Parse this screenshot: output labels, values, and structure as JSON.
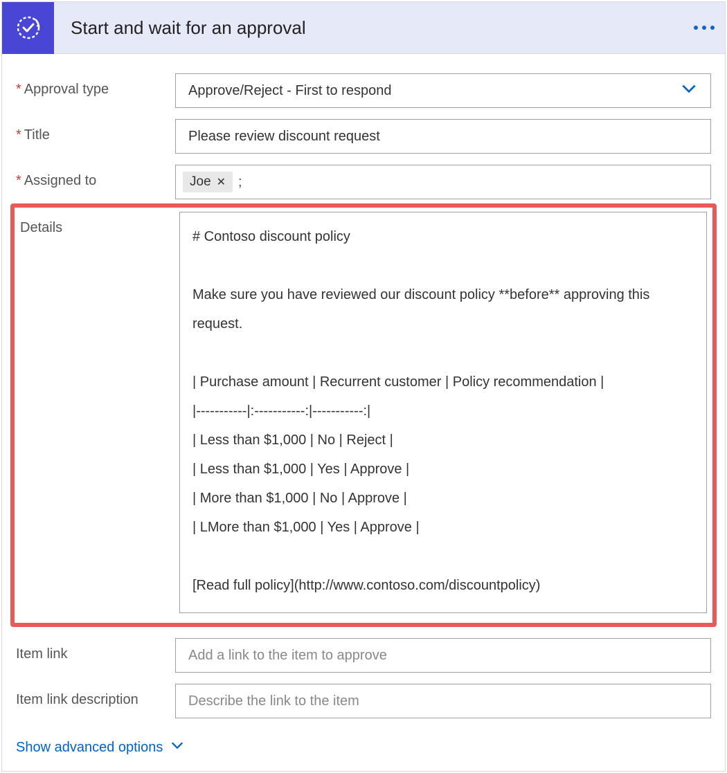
{
  "header": {
    "title": "Start and wait for an approval",
    "icon": "approval-check-icon"
  },
  "fields": {
    "approval_type": {
      "label": "Approval type",
      "value": "Approve/Reject - First to respond",
      "required": true
    },
    "title": {
      "label": "Title",
      "value": "Please review discount request",
      "required": true
    },
    "assigned_to": {
      "label": "Assigned to",
      "required": true,
      "tags": [
        "Joe"
      ],
      "separator": ";"
    },
    "details": {
      "label": "Details",
      "value": "# Contoso discount policy\n\nMake sure you have reviewed our discount policy **before** approving this request.\n\n| Purchase amount | Recurrent customer | Policy recommendation |\n|-----------|:-----------:|-----------:|\n| Less than $1,000 | No | Reject |\n| Less than $1,000 | Yes | Approve |\n| More than $1,000 | No | Approve |\n| LMore than $1,000 | Yes | Approve |\n\n[Read full policy](http://www.contoso.com/discountpolicy)"
    },
    "item_link": {
      "label": "Item link",
      "placeholder": "Add a link to the item to approve",
      "value": ""
    },
    "item_link_description": {
      "label": "Item link description",
      "placeholder": "Describe the link to the item",
      "value": ""
    }
  },
  "footer": {
    "advanced_options_label": "Show advanced options"
  },
  "required_marker": "*"
}
